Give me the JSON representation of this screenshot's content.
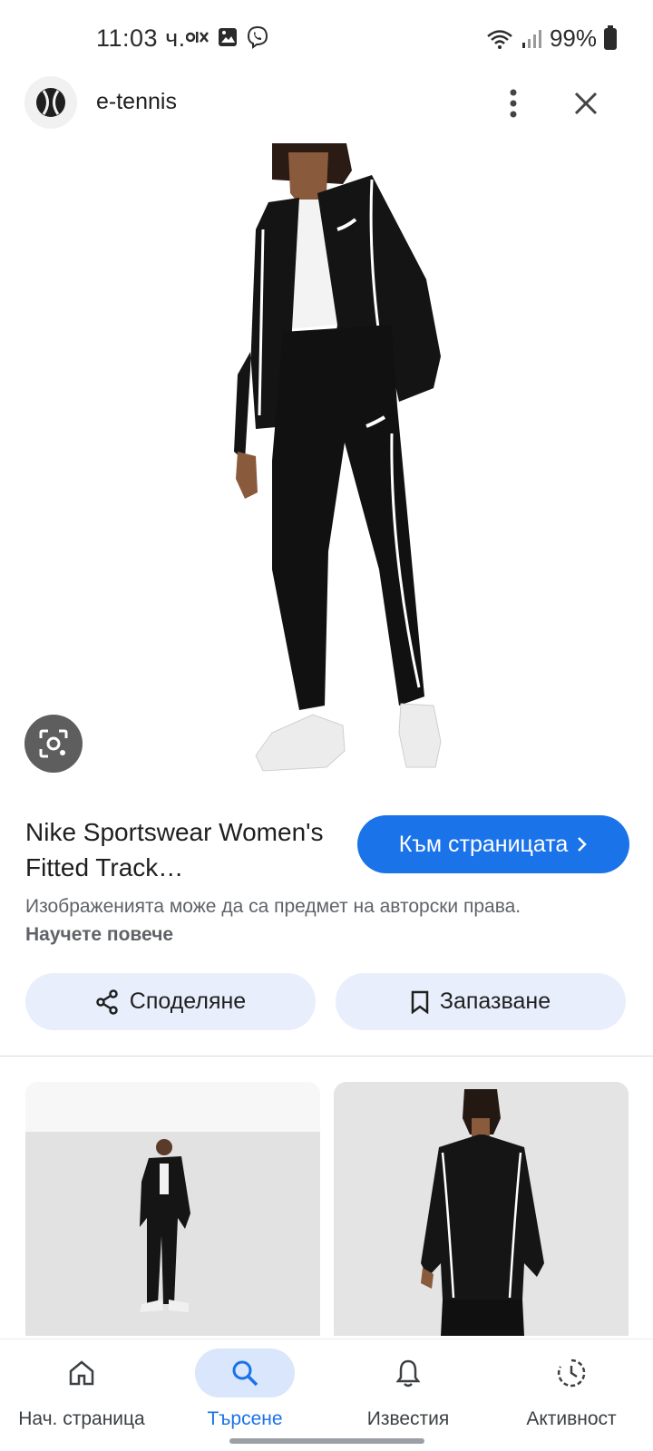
{
  "status_bar": {
    "time": "11:03 ч.",
    "battery": "99%",
    "icons": [
      "olx-icon",
      "gallery-icon",
      "viber-icon",
      "wifi-icon",
      "signal-icon",
      "battery-icon"
    ]
  },
  "header": {
    "site_name": "e-tennis"
  },
  "result": {
    "title": "Nike Sportswear Women's Fitted Track…",
    "visit_label": "Към страницата",
    "copyright_text": "Изображенията може да са предмет на авторски права.",
    "learn_more": "Научете повече"
  },
  "actions": {
    "share_label": "Споделяне",
    "save_label": "Запазване"
  },
  "bottom_nav": {
    "items": [
      {
        "label": "Нач. страница",
        "icon": "home-icon"
      },
      {
        "label": "Търсене",
        "icon": "search-icon",
        "active": true
      },
      {
        "label": "Известия",
        "icon": "bell-icon"
      },
      {
        "label": "Активност",
        "icon": "activity-icon"
      }
    ]
  },
  "colors": {
    "accent": "#1a73e8",
    "chip_bg": "#e8eefb",
    "active_nav_bg": "#d9e6fb"
  }
}
